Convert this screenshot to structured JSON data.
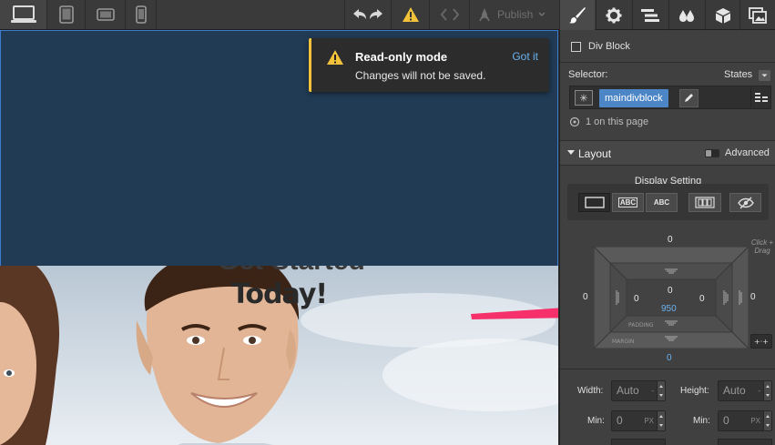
{
  "toolbar": {
    "publish_label": "Publish"
  },
  "canvas": {
    "hero_heading": "Today!",
    "hero_heading_cut": "Get Started"
  },
  "toast": {
    "title": "Read-only mode",
    "message": "Changes will not be saved.",
    "action": "Got it"
  },
  "panel": {
    "element_type": "Div Block",
    "selector_label": "Selector:",
    "states_label": "States",
    "selector_class": "maindivblock",
    "on_page": "1 on this page",
    "layout_title": "Layout",
    "advanced_label": "Advanced",
    "display_setting_label": "Display Setting",
    "display_options": [
      "ABC",
      "ABC"
    ],
    "boxmodel": {
      "margin_top": "0",
      "margin_left": "0",
      "margin_right": "0",
      "margin_bottom": "0",
      "padding_top": "0",
      "padding_left": "0",
      "padding_right": "0",
      "padding_bottom": "950",
      "padding_label": "PADDING",
      "margin_label": "MARGIN",
      "hint": "Click + Drag"
    },
    "size": {
      "width_label": "Width:",
      "width_value": "Auto",
      "height_label": "Height:",
      "height_value": "Auto",
      "min_label": "Min:",
      "min_width_value": "0",
      "min_height_label": "Min:",
      "min_height_value": "0",
      "unit": "PX"
    }
  }
}
